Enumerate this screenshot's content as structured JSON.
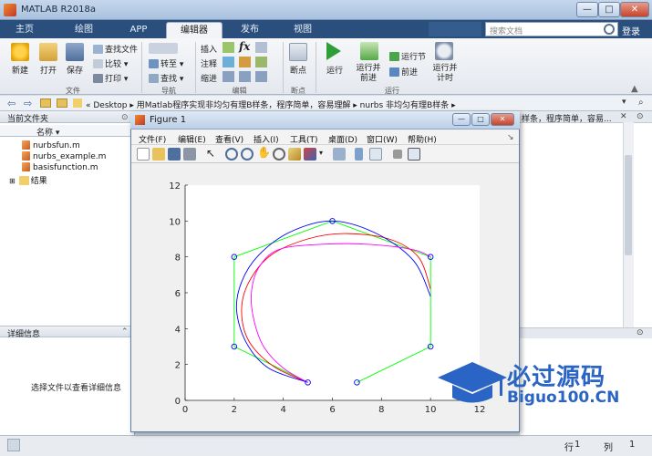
{
  "window": {
    "title": "MATLAB R2018a",
    "min": "—",
    "max": "□",
    "close": "✕"
  },
  "tabs": [
    "主页",
    "绘图",
    "APP",
    "编辑器",
    "发布",
    "视图"
  ],
  "search": {
    "placeholder": "搜索文档"
  },
  "login": "登录",
  "ribbon": {
    "file": {
      "new": "新建",
      "open": "打开",
      "save": "保存",
      "find_files": "查找文件",
      "compare": "比较",
      "print": "打印",
      "label": "文件"
    },
    "nav": {
      "goto": "转至",
      "find": "查找",
      "label": "导航"
    },
    "edit": {
      "insert": "插入",
      "comment": "注释",
      "indent": "缩进",
      "fx": "fx",
      "label": "编辑"
    },
    "breakpoints": {
      "bp": "断点",
      "label": "断点"
    },
    "run": {
      "run": "运行",
      "run_advance": "运行并\n前进",
      "run_section": "运行节",
      "advance": "前进",
      "run_time": "运行并\n计时",
      "label": "运行"
    }
  },
  "address": {
    "path": "« Desktop ▸ 用Matlab程序实现非均匀有理B样条，程序简单，容易理解 ▸ nurbs 非均匀有理B样条 ▸",
    "tail": "样条，程序简单，容易..."
  },
  "left": {
    "current_folder": "当前文件夹",
    "col_name": "名称 ▾",
    "files": [
      "nurbsfun.m",
      "nurbs_example.m",
      "basisfunction.m"
    ],
    "folder": "结果",
    "details": "详细信息",
    "details_hint": "选择文件以查看详细信息"
  },
  "status": {
    "row_label": "行",
    "row": "1",
    "col_label": "列",
    "col": "1"
  },
  "figure": {
    "title": "Figure 1",
    "menus": [
      "文件(F)",
      "编辑(E)",
      "查看(V)",
      "插入(I)",
      "工具(T)",
      "桌面(D)",
      "窗口(W)",
      "帮助(H)"
    ]
  },
  "colors": {
    "control": "#00ff00",
    "red_curve": "#ff0000",
    "blue_curve": "#0000ff",
    "magenta_curve": "#ff00ff",
    "marker": "#0000ff"
  },
  "chart_data": {
    "type": "line",
    "xlim": [
      0,
      12
    ],
    "ylim": [
      0,
      12
    ],
    "xticks": [
      0,
      2,
      4,
      6,
      8,
      10,
      12
    ],
    "yticks": [
      0,
      2,
      4,
      6,
      8,
      10,
      12
    ],
    "grid": false,
    "series": [
      {
        "key": "control",
        "style": "line+markers",
        "color": "#00ff00",
        "x": [
          5,
          2,
          2,
          6,
          10,
          10,
          7
        ],
        "y": [
          1,
          3,
          8,
          10,
          8,
          3,
          1
        ]
      },
      {
        "key": "red",
        "color": "#ff0000",
        "x": [
          5,
          3.6,
          2.6,
          2.3,
          2.6,
          3.5,
          5,
          6.5,
          8.3,
          9.5,
          10
        ],
        "y": [
          1,
          1.9,
          3.3,
          5,
          6.6,
          8.1,
          9.0,
          9.3,
          9.0,
          8.0,
          6.2
        ]
      },
      {
        "key": "blue",
        "color": "#0000ff",
        "x": [
          5,
          3.4,
          2.5,
          2.1,
          2.3,
          3.0,
          4.3,
          6.0,
          7.8,
          9.3,
          10
        ],
        "y": [
          1,
          1.8,
          3.2,
          5,
          6.6,
          8.1,
          9.4,
          10,
          9.3,
          7.8,
          5.8
        ]
      },
      {
        "key": "magenta",
        "color": "#ff00ff",
        "x": [
          5,
          4.0,
          3.2,
          2.8,
          2.7,
          3.0,
          3.8,
          5.5,
          7.5,
          9.3,
          10
        ],
        "y": [
          1,
          1.8,
          3.0,
          4.5,
          6.0,
          7.4,
          8.4,
          8.7,
          8.7,
          8.4,
          8.0
        ]
      }
    ]
  },
  "watermark": {
    "line1": "必过源码",
    "line2": "Biguo100.CN"
  }
}
